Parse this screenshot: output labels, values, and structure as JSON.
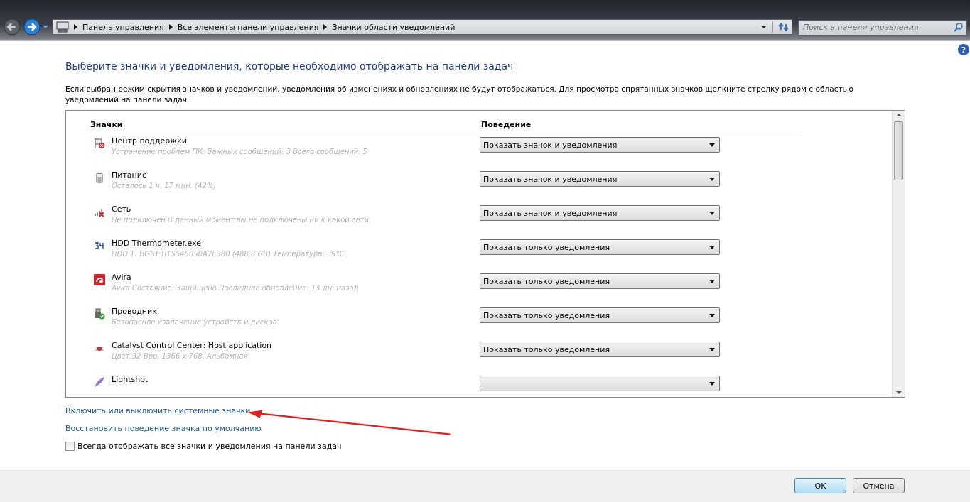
{
  "breadcrumb": [
    "Панель управления",
    "Все элементы панели управления",
    "Значки области уведомлений"
  ],
  "search": {
    "placeholder": "Поиск в панели управления"
  },
  "help": "?",
  "heading": "Выберите значки и уведомления, которые необходимо отображать на панели задач",
  "description": "Если выбран режим скрытия значков и уведомлений, уведомления об изменениях и обновлениях не будут отображаться. Для просмотра спрятанных значков щелкните стрелку рядом с областью уведомлений на панели задач.",
  "table": {
    "columns": [
      "Значки",
      "Поведение"
    ],
    "rows": [
      {
        "kind": "flag",
        "name": "Центр поддержки",
        "detail": "Устранение проблем ПК: Важных сообщений: 3  Всего сообщений: 5",
        "behavior": "Показать значок и уведомления"
      },
      {
        "kind": "battery",
        "name": "Питание",
        "detail": "Осталось 1 ч. 17 мин. (42%)",
        "behavior": "Показать значок и уведомления"
      },
      {
        "kind": "network",
        "name": "Сеть",
        "detail": "Не подключен В данный момент вы не подключены ни к какой сети.",
        "behavior": "Показать значок и уведомления"
      },
      {
        "kind": "thermo",
        "name": "HDD Thermometer.exe",
        "detail": "HDD 1: HGST HTS545050A7E380 (488,3 GB) Температура: 39°C",
        "behavior": "Показать только уведомления"
      },
      {
        "kind": "avira",
        "name": "Avira",
        "detail": "Avira  Состояние: Защищено  Последнее обновление: 13 дн. назад",
        "behavior": "Показать только уведомления"
      },
      {
        "kind": "usb",
        "name": "Проводник",
        "detail": "Безопасное извлечение устройств и дисков",
        "behavior": "Показать только уведомления"
      },
      {
        "kind": "catalyst",
        "name": "Catalyst Control Center: Host application",
        "detail": "Цвет:32 Bpp, 1366 x 768, Альбомная",
        "behavior": "Показать только уведомления"
      },
      {
        "kind": "feather",
        "name": "Lightshot"
      }
    ]
  },
  "links": [
    "Включить или выключить системные значки",
    "Восстановить поведение значка по умолчанию"
  ],
  "always_show": {
    "label": "Всегда отображать все значки и уведомления на панели задач",
    "checked": false
  },
  "buttons": [
    {
      "label": "OK",
      "default": true
    },
    {
      "label": "Отмена",
      "default": false
    }
  ]
}
